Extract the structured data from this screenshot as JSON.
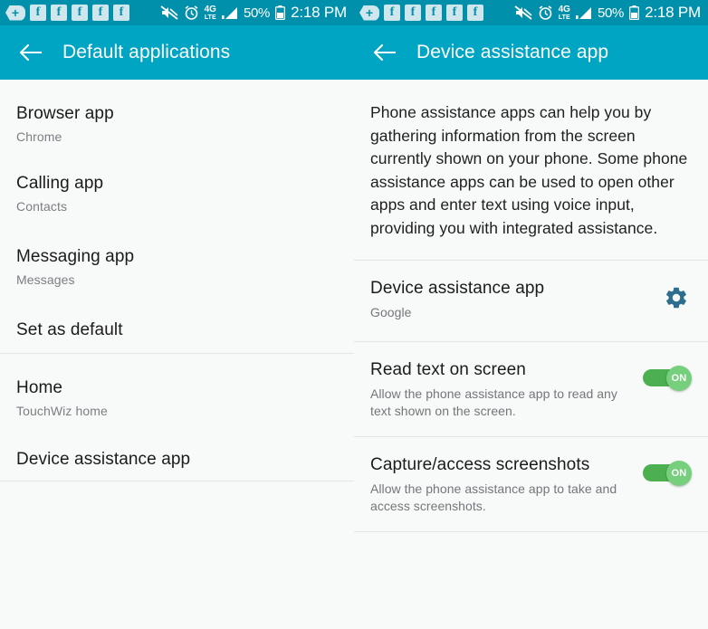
{
  "status_bar": {
    "notification_icons": [
      {
        "name": "more-notifications-icon",
        "glyph": "+"
      },
      {
        "name": "facebook-icon",
        "glyph": "f"
      },
      {
        "name": "facebook-icon",
        "glyph": "f"
      },
      {
        "name": "facebook-icon",
        "glyph": "f"
      },
      {
        "name": "facebook-icon",
        "glyph": "f"
      },
      {
        "name": "facebook-icon",
        "glyph": "f"
      }
    ],
    "mute_icon": "sound-muted-icon",
    "alarm_icon": "alarm-clock-icon",
    "network_label": "4G",
    "network_sub": "LTE",
    "signal_icon": "signal-bars-icon",
    "battery_percent": "50%",
    "battery_icon": "battery-icon",
    "clock": "2:18 PM",
    "background_color": "#0090ab"
  },
  "theme": {
    "accent": "#00a5c4",
    "status_bar": "#0090ab",
    "page_background": "#f8f9f9",
    "divider": "#e2e4e5",
    "gear_color": "#2d6e8e",
    "toggle_track_on": "#4caf50",
    "toggle_thumb_on": "#76cf7c"
  },
  "left_screen": {
    "header": {
      "back_label": "back-arrow",
      "title": "Default applications"
    },
    "groups": [
      {
        "items": [
          {
            "title": "Browser app",
            "subtitle": "Chrome"
          },
          {
            "title": "Calling app",
            "subtitle": "Contacts"
          },
          {
            "title": "Messaging app",
            "subtitle": "Messages"
          },
          {
            "title": "Set as default",
            "subtitle": ""
          }
        ]
      },
      {
        "items": [
          {
            "title": "Home",
            "subtitle": "TouchWiz home"
          },
          {
            "title": "Device assistance app",
            "subtitle": ""
          }
        ]
      }
    ]
  },
  "right_screen": {
    "header": {
      "back_label": "back-arrow",
      "title": "Device assistance app"
    },
    "intro": "Phone assistance apps can help you by gathering information from the screen currently shown on your phone. Some phone assistance apps can be used to open other apps and enter text using voice input, providing you with integrated assistance.",
    "rows": [
      {
        "title": "Device assistance app",
        "subtitle": "Google",
        "control": "gear",
        "gear_icon": "gear-icon"
      },
      {
        "title": "Read text on screen",
        "subtitle": "Allow the phone assistance app to read any text shown on the screen.",
        "control": "toggle",
        "toggle_state": "ON"
      },
      {
        "title": "Capture/access screenshots",
        "subtitle": "Allow the phone assistance app to take and access screenshots.",
        "control": "toggle",
        "toggle_state": "ON"
      }
    ]
  }
}
